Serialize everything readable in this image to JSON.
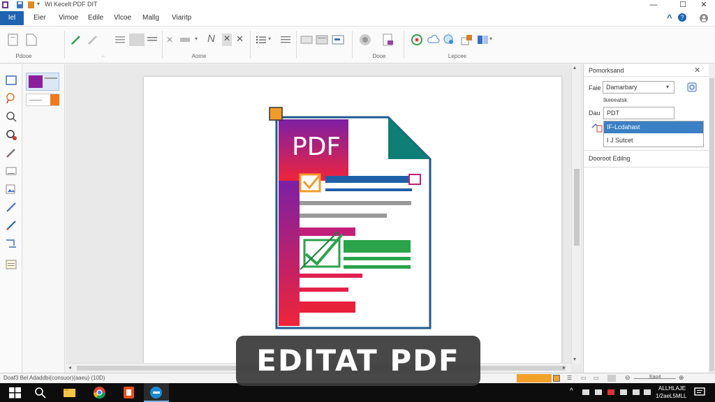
{
  "window": {
    "title": "Wi Kecelt:PDF DIT",
    "minimize_glyph": "—",
    "maximize_glyph": "☐",
    "close_glyph": "✕"
  },
  "menu": {
    "file_label": "Iel",
    "items": [
      "Eier",
      "Vimoe",
      "Edile",
      "Vlcoe",
      "Mallg",
      "Viaritp"
    ],
    "help_glyph": "?",
    "nav_glyph": "^"
  },
  "ribbon": {
    "groups": [
      "Pdooe",
      "Aome",
      "Dooe",
      "Lepcee"
    ]
  },
  "right_panel": {
    "title": "Pomorksand",
    "close_glyph": "✕",
    "field1_label": "Faie",
    "field1_value": "Damarbary",
    "sub_label": "Ikeeeatsk",
    "field2_label": "Dau",
    "field2_value": "PDT",
    "dropdown_options": [
      "IF-Lcdahast",
      "I J Sutcet"
    ],
    "section2_title": "Dooroot Edilng"
  },
  "statusbar": {
    "left_text": "Doaf3 Bel  Adaddbi(consuor)(aaeu)  (10D)",
    "zoom_text": "Eao4"
  },
  "taskbar": {
    "clock_time": "ALLHLAJE",
    "clock_date": "1/2aeL5MLL"
  },
  "document": {
    "pdf_text": "PDF"
  },
  "overlay": {
    "caption": "EDITAT PDF"
  },
  "colors": {
    "accent": "#1e63b0",
    "pdf_purple": "#8b1fa0",
    "pdf_red": "#e8203a",
    "pdf_teal": "#0f7f75",
    "pdf_blue": "#1f5fa8",
    "pdf_green": "#2aa34a",
    "pdf_orange": "#f39b2a"
  }
}
